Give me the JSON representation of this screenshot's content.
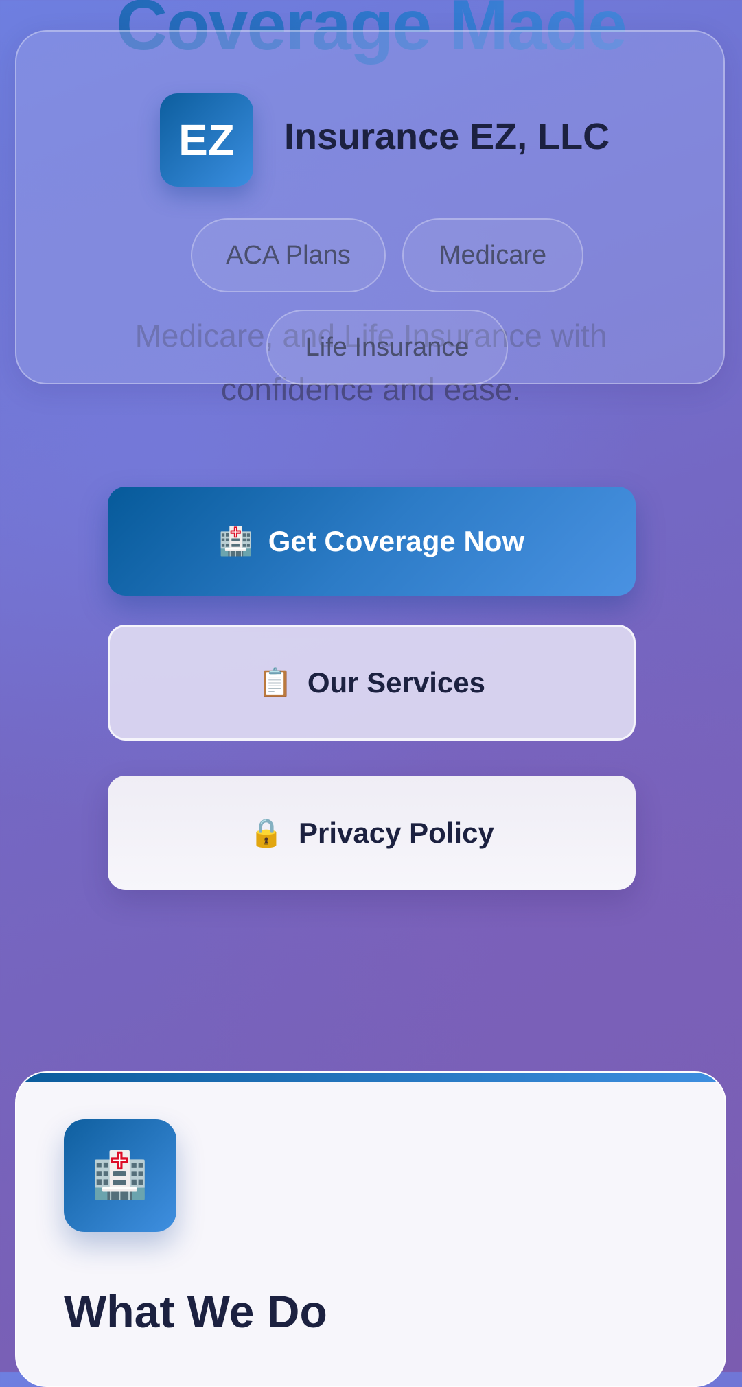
{
  "hero": {
    "title": "Coverage Made",
    "subtitle": "Medicare, and Life Insurance with confidence and ease."
  },
  "header": {
    "logo_text": "EZ",
    "brand_name": "Insurance EZ, LLC",
    "nav": [
      "ACA Plans",
      "Medicare",
      "Life Insurance"
    ]
  },
  "buttons": {
    "primary": {
      "icon": "🏥",
      "label": "Get Coverage Now"
    },
    "services": {
      "icon": "📋",
      "label": "Our Services"
    },
    "privacy": {
      "icon": "🔒",
      "label": "Privacy Policy"
    }
  },
  "card": {
    "icon": "🏥",
    "title": "What We Do"
  },
  "colors": {
    "brand_blue_dark": "#065a9a",
    "brand_blue_light": "#4a92e2",
    "text_dark": "#1c2140",
    "bg_top": "#6e7fe0",
    "bg_bottom": "#7b5cb0"
  },
  "icons": {
    "hospital": "hospital-icon",
    "clipboard": "clipboard-icon",
    "lock": "lock-icon"
  }
}
